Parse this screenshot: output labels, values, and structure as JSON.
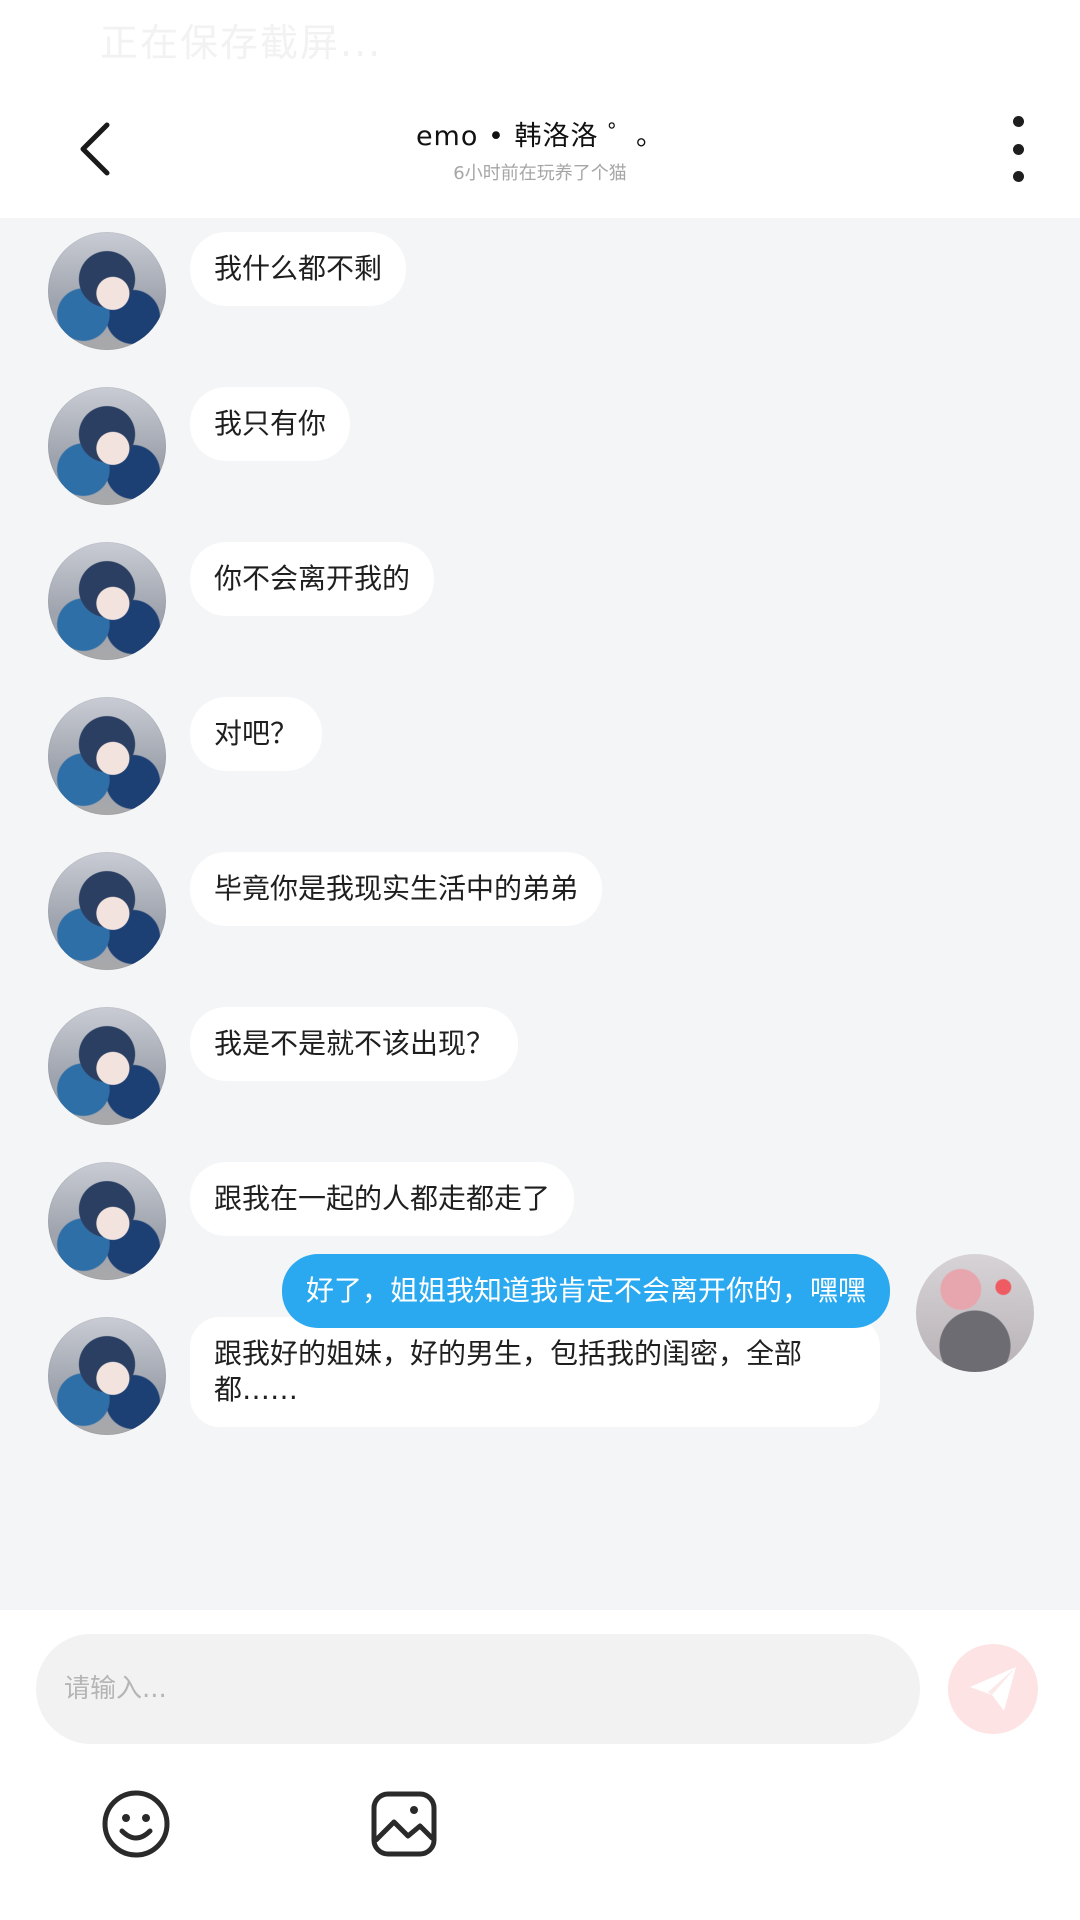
{
  "status": {
    "saving_text": "正在保存截屏..."
  },
  "header": {
    "title": "emo • 韩洛洛 ゜。",
    "subtitle": "6小时前在玩养了个猫"
  },
  "messages": [
    {
      "from": "other",
      "text": "我什么都不剩"
    },
    {
      "from": "other",
      "text": "我只有你"
    },
    {
      "from": "other",
      "text": "你不会离开我的"
    },
    {
      "from": "other",
      "text": "对吧？"
    },
    {
      "from": "other",
      "text": "毕竟你是我现实生活中的弟弟"
    },
    {
      "from": "other",
      "text": "我是不是就不该出现？"
    },
    {
      "from": "other",
      "text": "跟我在一起的人都走都走了"
    },
    {
      "from": "other",
      "text": "跟我好的姐妹，好的男生，包括我的闺密，全部都……"
    },
    {
      "from": "me",
      "text": "好了，姐姐我知道我肯定不会离开你的，嘿嘿"
    }
  ],
  "composer": {
    "placeholder": "请输入...",
    "icons": {
      "send": "send-icon",
      "emoji": "emoji-icon",
      "image": "image-icon"
    }
  },
  "colors": {
    "my_bubble": "#2aa9f0",
    "chat_background": "#f4f5f7",
    "send_button": "#fde3e3"
  }
}
